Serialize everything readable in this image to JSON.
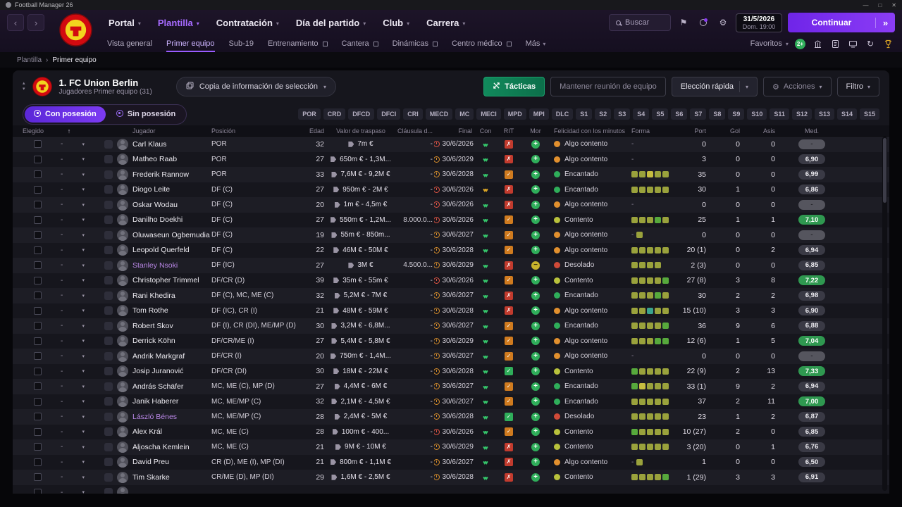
{
  "titlebar": {
    "app": "Football Manager 26"
  },
  "icons": {
    "chevron_down": "▾",
    "chevron_up": "▴",
    "back": "‹",
    "forward": "›",
    "continue_chevrons": "»",
    "breadcrumb_sep": "›",
    "window_min": "—",
    "window_max": "□",
    "window_close": "✕",
    "flag": "⚑",
    "gear": "⚙",
    "sync": "↻",
    "check": "✓",
    "cross": "✗",
    "hearts": "♥♥",
    "plus": "+",
    "minus": "−",
    "dash": "-",
    "sort_asc": "↑"
  },
  "nav": {
    "menus": [
      {
        "label": "Portal",
        "active": false
      },
      {
        "label": "Plantilla",
        "active": true
      },
      {
        "label": "Contratación",
        "active": false
      },
      {
        "label": "Día del partido",
        "active": false
      },
      {
        "label": "Club",
        "active": false
      },
      {
        "label": "Carrera",
        "active": false
      }
    ],
    "search_label": "Buscar",
    "date": "31/5/2026",
    "time": "Dom. 19:00",
    "continue": "Continuar"
  },
  "subnav": {
    "items": [
      {
        "label": "Vista general",
        "active": false,
        "ext": false,
        "dropdown": false
      },
      {
        "label": "Primer equipo",
        "active": true,
        "ext": false,
        "dropdown": false
      },
      {
        "label": "Sub-19",
        "active": false,
        "ext": false,
        "dropdown": false
      },
      {
        "label": "Entrenamiento",
        "active": false,
        "ext": true,
        "dropdown": false
      },
      {
        "label": "Cantera",
        "active": false,
        "ext": true,
        "dropdown": false
      },
      {
        "label": "Dinámicas",
        "active": false,
        "ext": true,
        "dropdown": false
      },
      {
        "label": "Centro médico",
        "active": false,
        "ext": true,
        "dropdown": false
      },
      {
        "label": "Más",
        "active": false,
        "ext": false,
        "dropdown": true
      }
    ],
    "favoritos": "Favoritos",
    "badge": "2+"
  },
  "breadcrumb": {
    "parent": "Plantilla",
    "current": "Primer equipo"
  },
  "squad_header": {
    "club": "1. FC Union Berlin",
    "subtitle": "Jugadores Primer equipo (31)",
    "copy_info": "Copia de información de selección",
    "tactics": "Tácticas",
    "meeting": "Mantener reunión de equipo",
    "quick_pick": "Elección rápida",
    "actions": "Acciones",
    "filter": "Filtro"
  },
  "view_toggle": {
    "with_ball": "Con posesión",
    "without_ball": "Sin posesión"
  },
  "position_filters": [
    "POR",
    "CRD",
    "DFCD",
    "DFCI",
    "CRI",
    "MECD",
    "MC",
    "MECI",
    "MPD",
    "MPI",
    "DLC",
    "S1",
    "S2",
    "S3",
    "S4",
    "S5",
    "S6",
    "S7",
    "S8",
    "S9",
    "S10",
    "S11",
    "S12",
    "S13",
    "S14",
    "S15"
  ],
  "table": {
    "headers": {
      "elegido": "Elegido",
      "sort": "↑",
      "jugador": "Jugador",
      "posicion": "Posición",
      "edad": "Edad",
      "valor": "Valor de traspaso",
      "clausula": "Cláusula d...",
      "final": "Final",
      "con": "Con",
      "rit": "RIT",
      "mor": "Mor",
      "felicidad": "Felicidad con los minutos ...",
      "forma": "Forma",
      "port": "Port",
      "gol": "Gol",
      "asis": "Asis",
      "med": "Med."
    },
    "rows": [
      {
        "name": "Carl Klaus",
        "unavailable": false,
        "position": "POR",
        "age": "32",
        "value": "7m €",
        "clause": "-",
        "contract_end": "30/6/2026",
        "clock": "red",
        "hearts": "green",
        "rit": "x",
        "morale": "plus",
        "happiness": "Algo contento",
        "happiness_level": "algo",
        "form": "-",
        "apps": "0",
        "goals": "0",
        "assists": "0",
        "rating": "-",
        "rating_style": "none"
      },
      {
        "name": "Matheo Raab",
        "unavailable": false,
        "position": "POR",
        "age": "27",
        "value": "650m € - 1,3M...",
        "clause": "-",
        "contract_end": "30/6/2029",
        "clock": "amber",
        "hearts": "green",
        "rit": "x",
        "morale": "plus",
        "happiness": "Algo contento",
        "happiness_level": "algo",
        "form": "-",
        "apps": "3",
        "goals": "0",
        "assists": "0",
        "rating": "6,90",
        "rating_style": "dark"
      },
      {
        "name": "Frederik Rannow",
        "unavailable": false,
        "position": "POR",
        "age": "33",
        "value": "7,6M € - 9,2M €",
        "clause": "-",
        "contract_end": "30/6/2028",
        "clock": "amber",
        "hearts": "green",
        "rit": "ok",
        "morale": "plus",
        "happiness": "Encantado",
        "happiness_level": "encantado",
        "form": "ooyoo",
        "apps": "35",
        "goals": "0",
        "assists": "0",
        "rating": "6,99",
        "rating_style": "dark"
      },
      {
        "name": "Diogo Leite",
        "unavailable": false,
        "position": "DF (C)",
        "age": "27",
        "value": "950m € - 2M €",
        "clause": "-",
        "contract_end": "30/6/2026",
        "clock": "red",
        "hearts": "gold",
        "rit": "x",
        "morale": "plus",
        "happiness": "Encantado",
        "happiness_level": "encantado",
        "form": "ooooo",
        "apps": "30",
        "goals": "1",
        "assists": "0",
        "rating": "6,86",
        "rating_style": "dark"
      },
      {
        "name": "Oskar Wodau",
        "unavailable": false,
        "position": "DF (C)",
        "age": "20",
        "value": "1m € - 4,5m €",
        "clause": "-",
        "contract_end": "30/6/2026",
        "clock": "red",
        "hearts": "green",
        "rit": "x",
        "morale": "plus",
        "happiness": "Algo contento",
        "happiness_level": "algo",
        "form": "-",
        "apps": "0",
        "goals": "0",
        "assists": "0",
        "rating": "-",
        "rating_style": "none"
      },
      {
        "name": "Danilho Doekhi",
        "unavailable": false,
        "position": "DF (C)",
        "age": "27",
        "value": "550m € - 1,2M...",
        "clause": "8.000.0...",
        "contract_end": "30/6/2026",
        "clock": "red",
        "hearts": "green",
        "rit": "ok",
        "morale": "plus",
        "happiness": "Contento",
        "happiness_level": "contento",
        "form": "ooogo",
        "apps": "25",
        "goals": "1",
        "assists": "1",
        "rating": "7,10",
        "rating_style": "green"
      },
      {
        "name": "Oluwaseun Ogbemudia",
        "unavailable": false,
        "position": "DF (C)",
        "age": "19",
        "value": "55m € - 850m...",
        "clause": "-",
        "contract_end": "30/6/2027",
        "clock": "amber",
        "hearts": "green",
        "rit": "ok",
        "morale": "plus",
        "happiness": "Algo contento",
        "happiness_level": "algo",
        "form": "-o",
        "apps": "0",
        "goals": "0",
        "assists": "0",
        "rating": "-",
        "rating_style": "none"
      },
      {
        "name": "Leopold Querfeld",
        "unavailable": false,
        "position": "DF (C)",
        "age": "22",
        "value": "46M € - 50M €",
        "clause": "-",
        "contract_end": "30/6/2028",
        "clock": "amber",
        "hearts": "green",
        "rit": "ok",
        "morale": "plus",
        "happiness": "Algo contento",
        "happiness_level": "algo",
        "form": "ooooo",
        "apps": "20 (1)",
        "goals": "0",
        "assists": "2",
        "rating": "6,94",
        "rating_style": "dark"
      },
      {
        "name": "Stanley Nsoki",
        "unavailable": true,
        "position": "DF (IC)",
        "age": "27",
        "value": "3M €",
        "clause": "4.500.0...",
        "contract_end": "30/6/2029",
        "clock": "amber",
        "hearts": "green",
        "rit": "x",
        "morale": "minus",
        "happiness": "Desolado",
        "happiness_level": "desolado",
        "form": "oooo",
        "apps": "2 (3)",
        "goals": "0",
        "assists": "0",
        "rating": "6,85",
        "rating_style": "dark"
      },
      {
        "name": "Christopher Trimmel",
        "unavailable": false,
        "position": "DF/CR (D)",
        "age": "39",
        "value": "35m € - 55m €",
        "clause": "-",
        "contract_end": "30/6/2026",
        "clock": "red",
        "hearts": "green",
        "rit": "ok",
        "morale": "plus",
        "happiness": "Contento",
        "happiness_level": "contento",
        "form": "oooog",
        "apps": "27 (8)",
        "goals": "3",
        "assists": "8",
        "rating": "7,22",
        "rating_style": "green"
      },
      {
        "name": "Rani Khedira",
        "unavailable": false,
        "position": "DF (C), MC, ME (C)",
        "age": "32",
        "value": "5,2M € - 7M €",
        "clause": "-",
        "contract_end": "30/6/2027",
        "clock": "amber",
        "hearts": "green",
        "rit": "x",
        "morale": "plus",
        "happiness": "Encantado",
        "happiness_level": "encantado",
        "form": "ooogo",
        "apps": "30",
        "goals": "2",
        "assists": "2",
        "rating": "6,98",
        "rating_style": "dark"
      },
      {
        "name": "Tom Rothe",
        "unavailable": false,
        "position": "DF (IC), CR (I)",
        "age": "21",
        "value": "48M € - 59M €",
        "clause": "-",
        "contract_end": "30/6/2028",
        "clock": "amber",
        "hearts": "green",
        "rit": "x",
        "morale": "plus",
        "happiness": "Algo contento",
        "happiness_level": "algo",
        "form": "ootoo",
        "apps": "15 (10)",
        "goals": "3",
        "assists": "3",
        "rating": "6,90",
        "rating_style": "dark"
      },
      {
        "name": "Robert Skov",
        "unavailable": false,
        "position": "DF (I), CR (DI), ME/MP (D)",
        "age": "30",
        "value": "3,2M € - 6,8M...",
        "clause": "-",
        "contract_end": "30/6/2027",
        "clock": "amber",
        "hearts": "green",
        "rit": "ok",
        "morale": "plus",
        "happiness": "Encantado",
        "happiness_level": "encantado",
        "form": "oooog",
        "apps": "36",
        "goals": "9",
        "assists": "6",
        "rating": "6,88",
        "rating_style": "dark"
      },
      {
        "name": "Derrick Köhn",
        "unavailable": false,
        "position": "DF/CR/ME (I)",
        "age": "27",
        "value": "5,4M € - 5,8M €",
        "clause": "-",
        "contract_end": "30/6/2029",
        "clock": "amber",
        "hearts": "green",
        "rit": "ok",
        "morale": "plus",
        "happiness": "Algo contento",
        "happiness_level": "algo",
        "form": "ooogg",
        "apps": "12 (6)",
        "goals": "1",
        "assists": "5",
        "rating": "7,04",
        "rating_style": "green"
      },
      {
        "name": "Andrik Markgraf",
        "unavailable": false,
        "position": "DF/CR (I)",
        "age": "20",
        "value": "750m € - 1,4M...",
        "clause": "-",
        "contract_end": "30/6/2027",
        "clock": "amber",
        "hearts": "green",
        "rit": "ok",
        "morale": "plus",
        "happiness": "Algo contento",
        "happiness_level": "algo",
        "form": "-",
        "apps": "0",
        "goals": "0",
        "assists": "0",
        "rating": "-",
        "rating_style": "none"
      },
      {
        "name": "Josip Juranović",
        "unavailable": false,
        "position": "DF/CR (DI)",
        "age": "30",
        "value": "18M € - 22M €",
        "clause": "-",
        "contract_end": "30/6/2028",
        "clock": "amber",
        "hearts": "green",
        "rit": "okg",
        "morale": "plus",
        "happiness": "Contento",
        "happiness_level": "contento",
        "form": "goooo",
        "apps": "22 (9)",
        "goals": "2",
        "assists": "13",
        "rating": "7,33",
        "rating_style": "green"
      },
      {
        "name": "András Schäfer",
        "unavailable": false,
        "position": "MC, ME (C), MP (D)",
        "age": "27",
        "value": "4,4M € - 6M €",
        "clause": "-",
        "contract_end": "30/6/2027",
        "clock": "amber",
        "hearts": "green",
        "rit": "ok",
        "morale": "plus",
        "happiness": "Encantado",
        "happiness_level": "encantado",
        "form": "gyooo",
        "apps": "33 (1)",
        "goals": "9",
        "assists": "2",
        "rating": "6,94",
        "rating_style": "dark"
      },
      {
        "name": "Janik Haberer",
        "unavailable": false,
        "position": "MC, ME/MP (C)",
        "age": "32",
        "value": "2,1M € - 4,5M €",
        "clause": "-",
        "contract_end": "30/6/2027",
        "clock": "amber",
        "hearts": "green",
        "rit": "ok",
        "morale": "plus",
        "happiness": "Encantado",
        "happiness_level": "encantado",
        "form": "ooooo",
        "apps": "37",
        "goals": "2",
        "assists": "11",
        "rating": "7,00",
        "rating_style": "green"
      },
      {
        "name": "László Bénes",
        "unavailable": true,
        "position": "MC, ME/MP (C)",
        "age": "28",
        "value": "2,4M € - 5M €",
        "clause": "-",
        "contract_end": "30/6/2028",
        "clock": "amber",
        "hearts": "green",
        "rit": "okg",
        "morale": "plus",
        "happiness": "Desolado",
        "happiness_level": "desolado",
        "form": "ooooo",
        "apps": "23",
        "goals": "1",
        "assists": "2",
        "rating": "6,87",
        "rating_style": "dark"
      },
      {
        "name": "Alex Král",
        "unavailable": false,
        "position": "MC, ME (C)",
        "age": "28",
        "value": "100m € - 400...",
        "clause": "-",
        "contract_end": "30/6/2026",
        "clock": "red",
        "hearts": "green",
        "rit": "ok",
        "morale": "plus",
        "happiness": "Contento",
        "happiness_level": "contento",
        "form": "goooo",
        "apps": "10 (27)",
        "goals": "2",
        "assists": "0",
        "rating": "6,85",
        "rating_style": "dark"
      },
      {
        "name": "Aljoscha Kemlein",
        "unavailable": false,
        "position": "MC, ME (C)",
        "age": "21",
        "value": "9M € - 10M €",
        "clause": "-",
        "contract_end": "30/6/2029",
        "clock": "amber",
        "hearts": "green",
        "rit": "x",
        "morale": "plus",
        "happiness": "Contento",
        "happiness_level": "contento",
        "form": "ooooo",
        "apps": "3 (20)",
        "goals": "0",
        "assists": "1",
        "rating": "6,76",
        "rating_style": "dark"
      },
      {
        "name": "David Preu",
        "unavailable": false,
        "position": "CR (D), ME (I), MP (DI)",
        "age": "21",
        "value": "800m € - 1,1M €",
        "clause": "-",
        "contract_end": "30/6/2027",
        "clock": "amber",
        "hearts": "green",
        "rit": "x",
        "morale": "plus",
        "happiness": "Algo contento",
        "happiness_level": "algo",
        "form": "-o",
        "apps": "1",
        "goals": "0",
        "assists": "0",
        "rating": "6,50",
        "rating_style": "dark"
      },
      {
        "name": "Tim Skarke",
        "unavailable": false,
        "position": "CR/ME (D), MP (DI)",
        "age": "29",
        "value": "1,6M € - 2,5M €",
        "clause": "-",
        "contract_end": "30/6/2028",
        "clock": "amber",
        "hearts": "green",
        "rit": "x",
        "morale": "plus",
        "happiness": "Contento",
        "happiness_level": "contento",
        "form": "oooog",
        "apps": "1 (29)",
        "goals": "3",
        "assists": "3",
        "rating": "6,91",
        "rating_style": "dark"
      },
      {
        "name": "",
        "unavailable": false,
        "position": "",
        "age": "",
        "value": "",
        "clause": "",
        "contract_end": "",
        "clock": "",
        "hearts": "",
        "rit": "",
        "morale": "",
        "happiness": "",
        "happiness_level": "",
        "form": "",
        "apps": "",
        "goals": "",
        "assists": "",
        "rating": "",
        "rating_style": ""
      }
    ]
  }
}
